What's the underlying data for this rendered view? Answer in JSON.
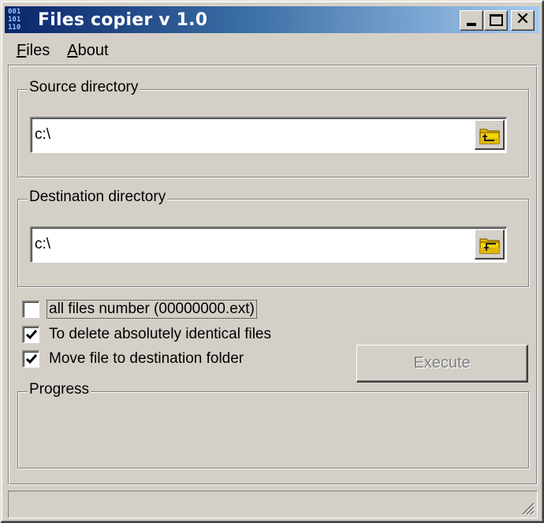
{
  "window": {
    "title": "Files copier v 1.0",
    "icon": "binary-digits-icon",
    "controls": {
      "minimize": "minimize-icon",
      "maximize": "maximize-icon",
      "close": "close-icon"
    }
  },
  "menu": {
    "items": [
      {
        "label_mnemonic": "F",
        "label_rest": "iles"
      },
      {
        "label_mnemonic": "A",
        "label_rest": "bout"
      }
    ]
  },
  "source": {
    "group_label": "Source directory",
    "path_value": "c:\\",
    "browse_icon": "folder-up-arrow-icon"
  },
  "destination": {
    "group_label": "Destination directory",
    "path_value": "c:\\",
    "browse_icon": "folder-down-arrow-icon"
  },
  "options": [
    {
      "label": "all files number (00000000.ext)",
      "checked": false,
      "focused": true
    },
    {
      "label": "To delete absolutely identical files",
      "checked": true,
      "focused": false
    },
    {
      "label": "Move file to destination folder",
      "checked": true,
      "focused": false
    }
  ],
  "execute": {
    "label": "Execute",
    "enabled": false
  },
  "progress": {
    "group_label": "Progress"
  },
  "statusbar": {
    "text": ""
  },
  "colors": {
    "face": "#d4d0c8",
    "title_start": "#0a246a",
    "title_end": "#a6caf0",
    "folder": "#e8c000"
  }
}
